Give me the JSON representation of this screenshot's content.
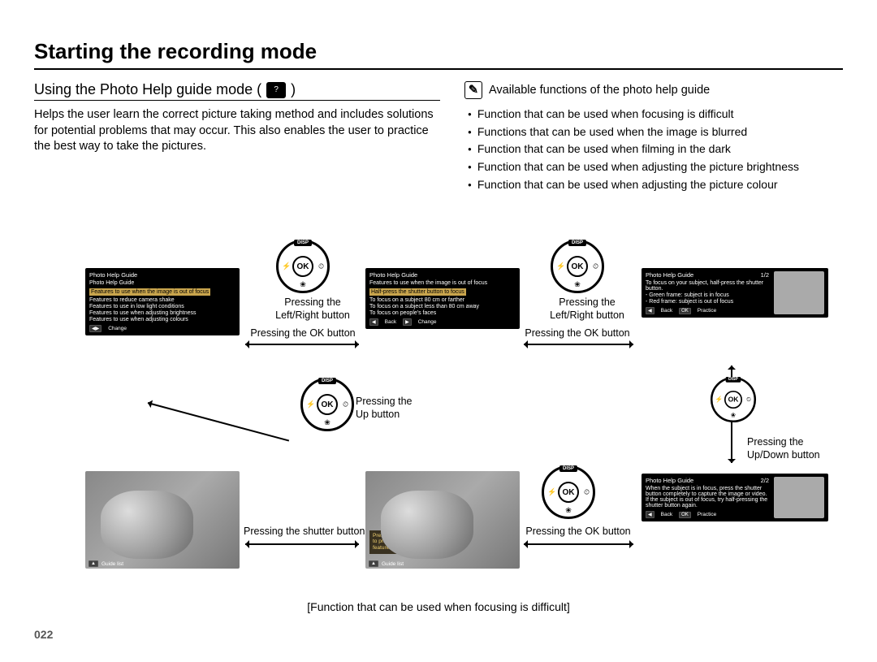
{
  "page_number": "022",
  "heading": "Starting the recording mode",
  "subheading_prefix": "Using the Photo Help guide mode ( ",
  "subheading_suffix": " )",
  "intro": "Helps the user learn the correct picture taking method and includes solutions for potential problems that may occur. This also enables the user to practice the best way to take the pictures.",
  "note_heading": "Available functions of the photo help guide",
  "functions": [
    "Function that can be used when focusing is difficult",
    "Functions that can be used when the image is blurred",
    "Function that can be used when filming in the dark",
    "Function that can be used when adjusting the picture brightness",
    "Function that can be used when adjusting the picture colour"
  ],
  "dial": {
    "disp": "DISP",
    "ok": "OK",
    "left": "⚡",
    "right": "⏲",
    "bottom": "❀"
  },
  "captions": {
    "press_lr": "Pressing the\nLeft/Right button",
    "press_ok": "Pressing the OK button",
    "press_up": "Pressing the\nUp button",
    "press_ud": "Pressing the\nUp/Down button",
    "press_shutter": "Pressing the shutter button"
  },
  "bottom_caption": "[Function that can be used when focusing is difficult]",
  "screens": {
    "A": {
      "title": "Photo Help Guide",
      "sub": "Photo Help Guide",
      "hl": "Features to use when the image is out of focus",
      "rows": [
        "Features to reduce camera shake",
        "Features to use in low light conditions",
        "Features to use when adjusting brightness",
        "Features to use when adjusting colours"
      ],
      "foot_left_btn": "◀▶",
      "foot_left": "Change"
    },
    "B": {
      "title": "Photo Help Guide",
      "sub": "Features to use when the image is out of focus",
      "hl": "Half-press the shutter button to focus",
      "rows": [
        "To focus on a subject 80 cm or farther",
        "To focus on a subject less than 80 cm away",
        "To focus on people's faces"
      ],
      "foot_back_btn": "◀",
      "foot_back": "Back",
      "foot_change_btn": "▶",
      "foot_change": "Change"
    },
    "C": {
      "title": "Photo Help Guide",
      "page": "1/2",
      "rows": [
        "To focus on your subject, half-press the shutter button.",
        "- Green frame: subject is in focus",
        "- Red frame: subject is out of focus"
      ],
      "foot_back_btn": "◀",
      "foot_back": "Back",
      "foot_ok_btn": "OK",
      "foot_ok": "Practice"
    },
    "D": {
      "title": "Photo Help Guide",
      "page": "2/2",
      "rows": [
        "When the subject is in focus, press the shutter button completely to capture the image or video. If the subject is out of focus, try half-pressing the shutter button again."
      ],
      "foot_back_btn": "◀",
      "foot_back": "Back",
      "foot_ok_btn": "OK",
      "foot_ok": "Practice"
    },
    "photo1": {
      "foot_btn": "▲",
      "foot": "Guide list"
    },
    "photo2": {
      "overlay": [
        "Press the shutter button",
        "to practice using this",
        "feature."
      ],
      "foot_btn": "▲",
      "foot": "Guide list"
    }
  }
}
